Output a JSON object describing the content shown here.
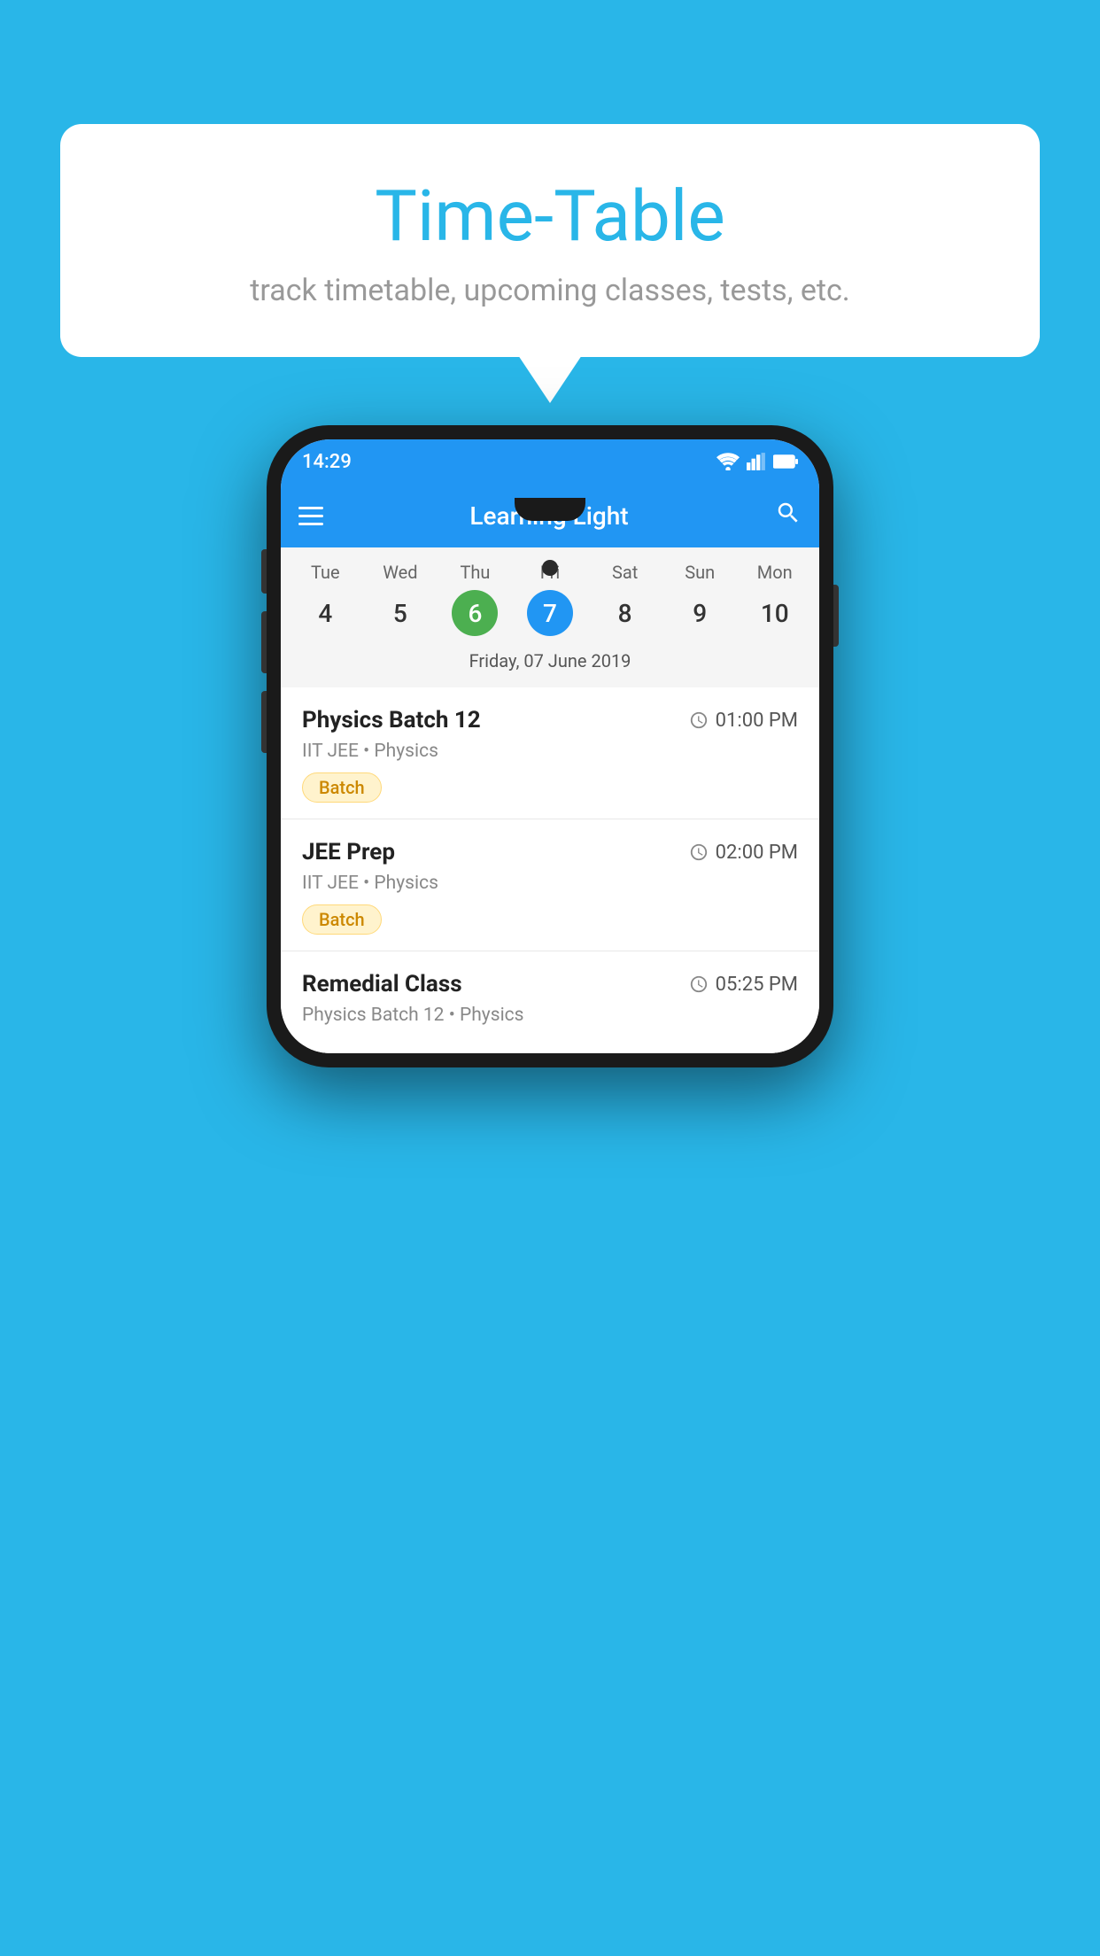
{
  "background": {
    "color": "#29B6E8"
  },
  "speech_bubble": {
    "title": "Time-Table",
    "subtitle": "track timetable, upcoming classes, tests, etc."
  },
  "phone": {
    "status_bar": {
      "time": "14:29"
    },
    "app_bar": {
      "title": "Learning Light"
    },
    "calendar": {
      "days": [
        {
          "name": "Tue",
          "num": "4",
          "state": "normal"
        },
        {
          "name": "Wed",
          "num": "5",
          "state": "normal"
        },
        {
          "name": "Thu",
          "num": "6",
          "state": "today"
        },
        {
          "name": "Fri",
          "num": "7",
          "state": "selected"
        },
        {
          "name": "Sat",
          "num": "8",
          "state": "normal"
        },
        {
          "name": "Sun",
          "num": "9",
          "state": "normal"
        },
        {
          "name": "Mon",
          "num": "10",
          "state": "normal"
        }
      ],
      "selected_date_label": "Friday, 07 June 2019"
    },
    "schedule": [
      {
        "title": "Physics Batch 12",
        "time": "01:00 PM",
        "subtitle": "IIT JEE • Physics",
        "badge": "Batch"
      },
      {
        "title": "JEE Prep",
        "time": "02:00 PM",
        "subtitle": "IIT JEE • Physics",
        "badge": "Batch"
      },
      {
        "title": "Remedial Class",
        "time": "05:25 PM",
        "subtitle": "Physics Batch 12 • Physics",
        "badge": null
      }
    ]
  }
}
